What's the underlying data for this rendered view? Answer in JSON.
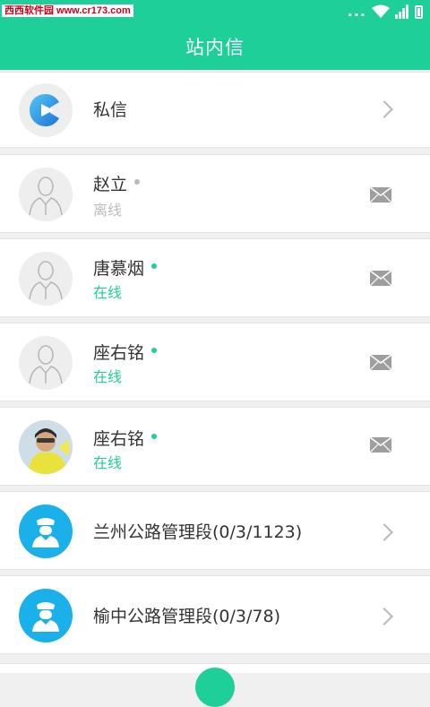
{
  "statusbar": {
    "watermark": "西西软件园 www.cr173.com",
    "dots": "..."
  },
  "header": {
    "title": "站内信"
  },
  "rows": {
    "private": {
      "label": "私信"
    },
    "c1": {
      "name": "赵立",
      "status": "离线"
    },
    "c2": {
      "name": "唐慕烟",
      "status": "在线"
    },
    "c3": {
      "name": "座右铭",
      "status": "在线"
    },
    "c4": {
      "name": "座右铭",
      "status": "在线"
    },
    "g1": {
      "label": "兰州公路管理段(0/3/1123)"
    },
    "g2": {
      "label": "榆中公路管理段(0/3/78)"
    }
  },
  "colors": {
    "accent": "#1ecf9a",
    "online": "#1ecf9a",
    "offline": "#bbbbbb",
    "group_avatar": "#1ab0ea"
  },
  "icons": {
    "private_avatar": "play-logo-icon",
    "contact_avatar": "person-placeholder-icon",
    "group_avatar": "officer-icon",
    "mail": "envelope-icon",
    "chevron": "chevron-right-icon"
  }
}
